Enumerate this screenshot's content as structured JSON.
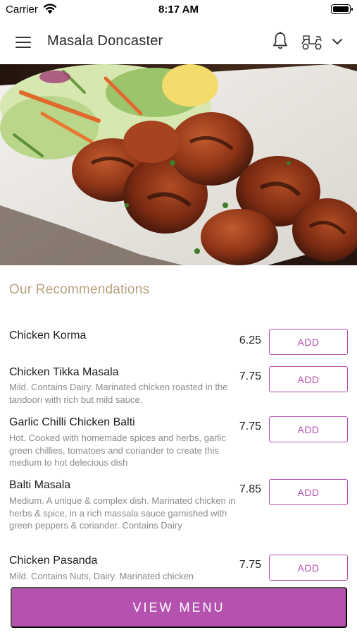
{
  "status_bar": {
    "carrier": "Carrier",
    "time": "8:17 AM"
  },
  "header": {
    "title": "Masala Doncaster",
    "icons": [
      "menu-icon",
      "bell-icon",
      "delivery-scooter-icon",
      "chevron-down-icon"
    ]
  },
  "hero": {
    "description_icon": "food-photo"
  },
  "recommendations": {
    "title": "Our Recommendations",
    "add_label": "ADD",
    "items": [
      {
        "name": "Chicken Korma",
        "price": "6.25",
        "description": ""
      },
      {
        "name": "Chicken Tikka Masala",
        "price": "7.75",
        "description": "Mild. Contains Dairy. Marinated chicken roasted in the tandoori with rich but mild sauce."
      },
      {
        "name": "Garlic Chilli Chicken Balti",
        "price": "7.75",
        "description": "Hot. Cooked with homemade spices and herbs, garlic green chillies, tomatoes and coriander to create this medium to hot delecious dish"
      },
      {
        "name": "Balti Masala",
        "price": "7.85",
        "description": "Medium. A unique & complex dish. Marinated chicken in herbs & spice, in a rich massala sauce garnished with green peppers & coriander. Contains Dairy"
      },
      {
        "name": "Chicken Pasanda",
        "price": "7.75",
        "description": "Mild. Contains Nuts, Dairy. Marinated chicken"
      }
    ]
  },
  "footer": {
    "view_menu_label": "VIEW MENU"
  },
  "colors": {
    "accent": "#b552b0",
    "section_title": "#b5a27e",
    "description": "#8a8a8a"
  }
}
